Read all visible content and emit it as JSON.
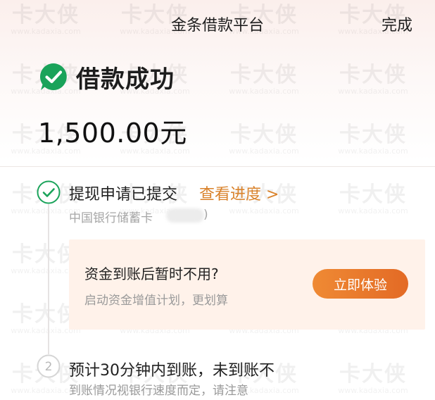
{
  "watermark": {
    "text": "卡大侠",
    "url": "www.kadaxia.com"
  },
  "header": {
    "title": "金条借款平台",
    "done_label": "完成"
  },
  "success": {
    "icon": "check-circle-icon",
    "title": "借款成功",
    "color": "#1aa35a"
  },
  "amount": "1,500.00元",
  "steps": [
    {
      "icon": "check-circle-outline-icon",
      "title": "提现申请已提交",
      "link_label": "查看进度 >",
      "bank": "中国银行储蓄卡",
      "bank_close": ")"
    },
    {
      "icon_number": "2",
      "title": "预计30分钟内到账，未到账不",
      "description": "到账情况视银行速度而定，请注意"
    }
  ],
  "promo": {
    "title": "资金到账后暂时不用?",
    "subtitle": "启动资金增值计划，更划算",
    "button_label": "立即体验",
    "accent_color": "#e9762c"
  }
}
